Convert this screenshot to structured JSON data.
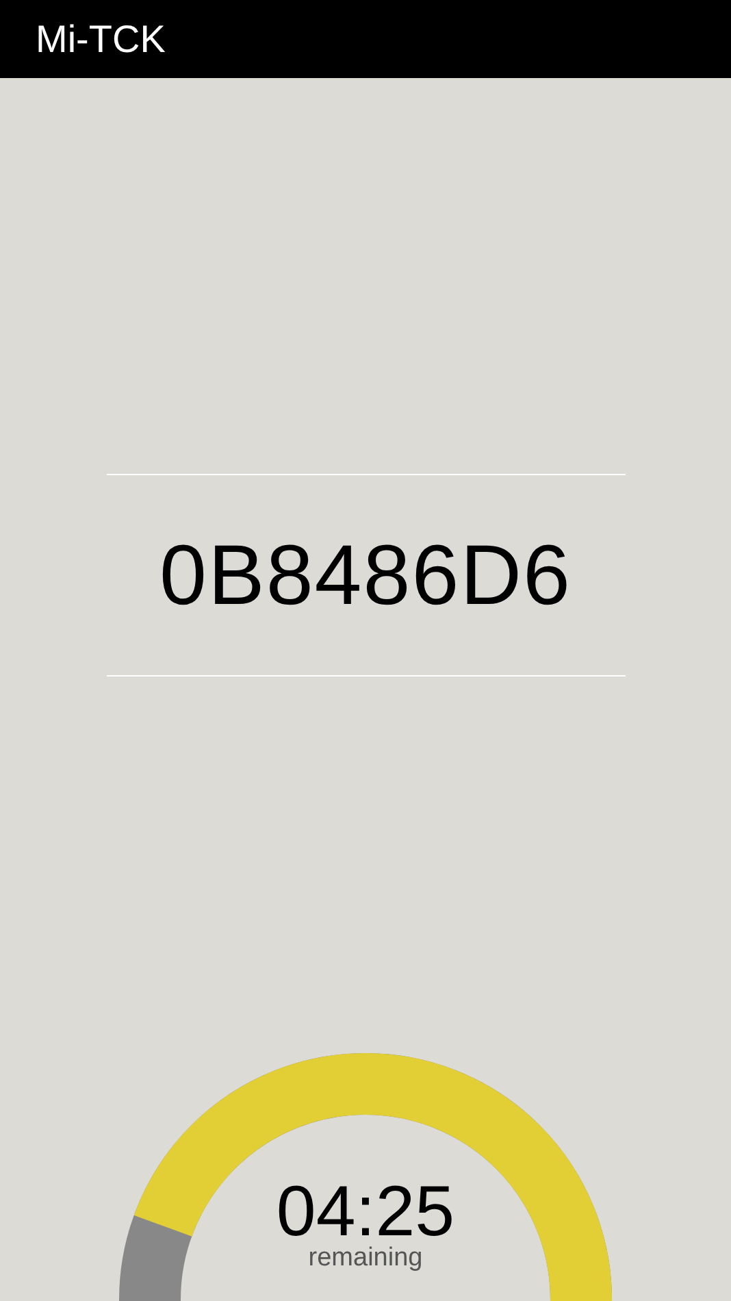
{
  "app_bar": {
    "title": "Mi-TCK"
  },
  "code": {
    "value": "0B8486D6"
  },
  "timer": {
    "time": "04:25",
    "caption": "remaining"
  }
}
